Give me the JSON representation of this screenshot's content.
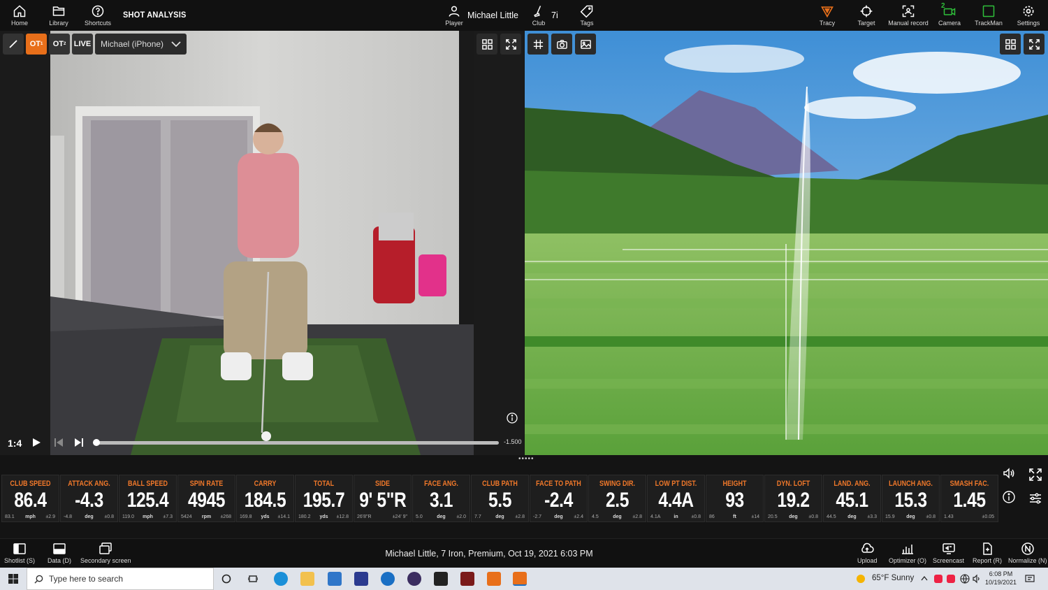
{
  "topbar": {
    "home_label": "Home",
    "library_label": "Library",
    "shortcuts_label": "Shortcuts",
    "title": "SHOT ANALYSIS",
    "player_name": "Michael Little",
    "player_label": "Player",
    "club_label": "Club",
    "club_value": "7i",
    "tags_label": "Tags",
    "tracy_label": "Tracy",
    "target_label": "Target",
    "manual_record_label": "Manual record",
    "camera_label": "Camera",
    "camera_badge": "2",
    "trackman_label": "TrackMan",
    "settings_label": "Settings"
  },
  "video": {
    "ot1_label": "OT",
    "ot1_sub": "1",
    "ot2_label": "OT",
    "ot2_sub": "2",
    "live_label": "LIVE",
    "camera_source": "Michael (iPhone)",
    "speed": "1:4",
    "end_time": "-1.500",
    "playhead_fraction": 0.0
  },
  "metrics": [
    {
      "label": "CLUB SPEED",
      "value": "86.4",
      "unit": "mph",
      "lo": "83.1",
      "hi": "±2.9"
    },
    {
      "label": "ATTACK ANG.",
      "value": "-4.3",
      "unit": "deg",
      "lo": "-4.8",
      "hi": "±0.8"
    },
    {
      "label": "BALL SPEED",
      "value": "125.4",
      "unit": "mph",
      "lo": "119.0",
      "hi": "±7.3"
    },
    {
      "label": "SPIN RATE",
      "value": "4945",
      "unit": "rpm",
      "lo": "5424",
      "hi": "±268"
    },
    {
      "label": "CARRY",
      "value": "184.5",
      "unit": "yds",
      "lo": "169.8",
      "hi": "±14.1"
    },
    {
      "label": "TOTAL",
      "value": "195.7",
      "unit": "yds",
      "lo": "180.2",
      "hi": "±12.8"
    },
    {
      "label": "SIDE",
      "value": "9' 5\"R",
      "unit": "",
      "lo": "26'8\"R",
      "hi": "±24' 9\""
    },
    {
      "label": "FACE ANG.",
      "value": "3.1",
      "unit": "deg",
      "lo": "5.0",
      "hi": "±2.0"
    },
    {
      "label": "CLUB PATH",
      "value": "5.5",
      "unit": "deg",
      "lo": "7.7",
      "hi": "±2.8"
    },
    {
      "label": "FACE TO PATH",
      "value": "-2.4",
      "unit": "deg",
      "lo": "-2.7",
      "hi": "±2.4"
    },
    {
      "label": "SWING DIR.",
      "value": "2.5",
      "unit": "deg",
      "lo": "4.5",
      "hi": "±2.8"
    },
    {
      "label": "LOW PT DIST.",
      "value": "4.4A",
      "unit": "in",
      "lo": "4.1A",
      "hi": "±0.8"
    },
    {
      "label": "HEIGHT",
      "value": "93",
      "unit": "ft",
      "lo": "86",
      "hi": "±14"
    },
    {
      "label": "DYN. LOFT",
      "value": "19.2",
      "unit": "deg",
      "lo": "20.5",
      "hi": "±0.8"
    },
    {
      "label": "LAND. ANG.",
      "value": "45.1",
      "unit": "deg",
      "lo": "44.5",
      "hi": "±3.3"
    },
    {
      "label": "LAUNCH ANG.",
      "value": "15.3",
      "unit": "deg",
      "lo": "15.9",
      "hi": "±0.8"
    },
    {
      "label": "SMASH FAC.",
      "value": "1.45",
      "unit": "",
      "lo": "1.43",
      "hi": "±0.05"
    }
  ],
  "bottombar": {
    "shotlist_label": "Shotlist (S)",
    "data_label": "Data (D)",
    "secondary_label": "Secondary screen",
    "shot_info": "Michael Little, 7 Iron, Premium, Oct 19, 2021 6:03 PM",
    "upload_label": "Upload",
    "optimizer_label": "Optimizer (O)",
    "screencast_label": "Screencast",
    "report_label": "Report (R)",
    "normalize_label": "Normalize (N)"
  },
  "taskbar": {
    "search_placeholder": "Type here to search",
    "weather": "65°F  Sunny",
    "time": "6:08 PM",
    "date": "10/19/2021"
  },
  "colors": {
    "accent": "#e86f1a",
    "metric_label": "#f0782a",
    "camera_green": "#2fbf3a"
  }
}
